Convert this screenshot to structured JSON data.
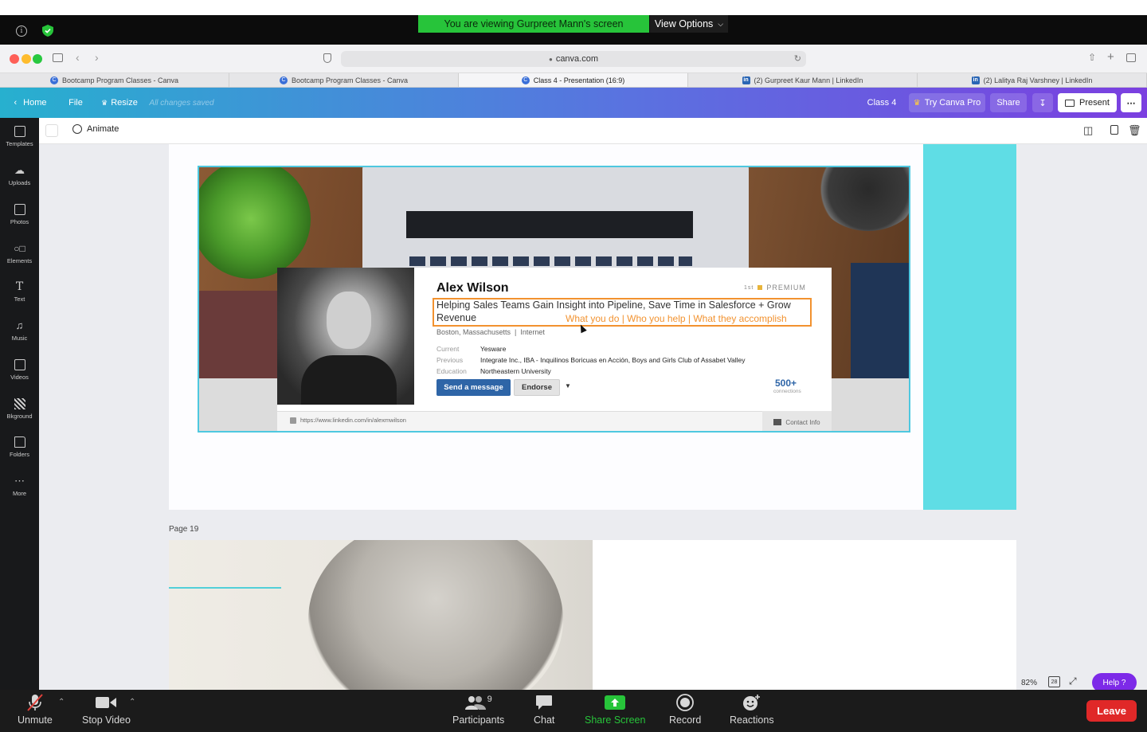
{
  "zoom": {
    "viewing_banner": "You are viewing Gurpreet Mann's screen",
    "view_options": "View Options",
    "controls": {
      "unmute": "Unmute",
      "stop_video": "Stop Video",
      "participants": "Participants",
      "participants_count": "9",
      "chat": "Chat",
      "share_screen": "Share Screen",
      "record": "Record",
      "reactions": "Reactions",
      "leave": "Leave"
    }
  },
  "browser": {
    "url": "canva.com",
    "tabs": [
      {
        "label": "Bootcamp Program Classes - Canva",
        "icon": "canva-icon"
      },
      {
        "label": "Bootcamp Program Classes - Canva",
        "icon": "canva-icon"
      },
      {
        "label": "Class 4 - Presentation (16:9)",
        "icon": "canva-icon",
        "active": true
      },
      {
        "label": "(2) Gurpreet Kaur Mann | LinkedIn",
        "icon": "linkedin-icon"
      },
      {
        "label": "(2) Lalitya Raj Varshney | LinkedIn",
        "icon": "linkedin-icon"
      }
    ]
  },
  "canva": {
    "header": {
      "home": "Home",
      "file": "File",
      "resize": "Resize",
      "saved_status": "All changes saved",
      "doc_title": "Class 4",
      "try_pro": "Try Canva Pro",
      "share": "Share",
      "present": "Present"
    },
    "toolbar": {
      "animate": "Animate"
    },
    "sidebar": [
      {
        "label": "Templates",
        "icon": "templates-icon"
      },
      {
        "label": "Uploads",
        "icon": "upload-icon"
      },
      {
        "label": "Photos",
        "icon": "photos-icon"
      },
      {
        "label": "Elements",
        "icon": "elements-icon"
      },
      {
        "label": "Text",
        "icon": "text-icon"
      },
      {
        "label": "Music",
        "icon": "music-icon"
      },
      {
        "label": "Videos",
        "icon": "videos-icon"
      },
      {
        "label": "Bkground",
        "icon": "background-icon"
      },
      {
        "label": "Folders",
        "icon": "folders-icon"
      },
      {
        "label": "More",
        "icon": "more-icon"
      }
    ],
    "page_label": "Page 19",
    "zoom_level": "82%",
    "page_count": "28",
    "help": "Help ?"
  },
  "linkedin_card": {
    "name": "Alex Wilson",
    "badge": "PREMIUM",
    "badge_degree": "1st",
    "headline_line1": "Helping Sales Teams Gain Insight into Pipeline, Save Time in Salesforce + Grow",
    "headline_line2": "Revenue",
    "annotation": "What you do | Who you help | What they accomplish",
    "location": "Boston, Massachusetts",
    "industry": "Internet",
    "current_label": "Current",
    "current_value": "Yesware",
    "previous_label": "Previous",
    "previous_value": "Integrate Inc., IBA - Inquilinos Boricuas en Acción, Boys and Girls Club of Assabet Valley",
    "education_label": "Education",
    "education_value": "Northeastern University",
    "send_message": "Send a message",
    "endorse": "Endorse",
    "connections": "500+",
    "connections_label": "connections",
    "profile_url": "https://www.linkedin.com/in/alexmwilson",
    "contact_info": "Contact Info"
  }
}
